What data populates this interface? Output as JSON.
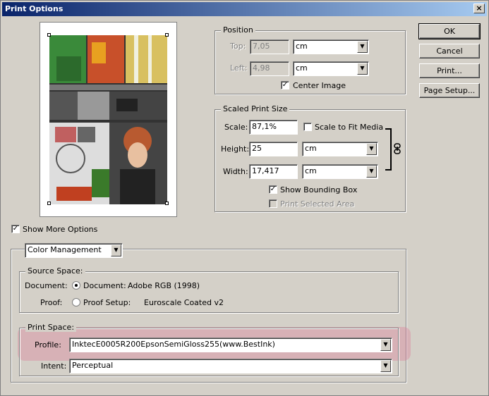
{
  "window": {
    "title": "Print Options",
    "close_glyph": "×"
  },
  "buttons": {
    "ok": "OK",
    "cancel": "Cancel",
    "print": "Print...",
    "page_setup": "Page Setup..."
  },
  "position": {
    "legend": "Position",
    "top_label": "Top:",
    "top_value": "7,05",
    "top_unit": "cm",
    "left_label": "Left:",
    "left_value": "4,98",
    "left_unit": "cm",
    "center_image": "Center Image"
  },
  "scaled": {
    "legend": "Scaled Print Size",
    "scale_label": "Scale:",
    "scale_value": "87,1%",
    "scale_to_fit": "Scale to Fit Media",
    "height_label": "Height:",
    "height_value": "25",
    "height_unit": "cm",
    "width_label": "Width:",
    "width_value": "17,417",
    "width_unit": "cm",
    "show_bounding_box": "Show Bounding Box",
    "print_selected_area": "Print Selected Area"
  },
  "show_more_options": "Show More Options",
  "more": {
    "mode_select": "Color Management",
    "source_legend": "Source Space:",
    "document_label": "Document:",
    "document_option": "Document:",
    "document_value": "Adobe RGB (1998)",
    "proof_label": "Proof:",
    "proof_option": "Proof Setup:",
    "proof_value": "Euroscale Coated v2",
    "print_legend": "Print Space:",
    "profile_label": "Profile:",
    "profile_value": "InktecE0005R200EpsonSemiGloss255(www.BestInk)",
    "intent_label": "Intent:",
    "intent_value": "Perceptual"
  },
  "icons": {
    "dropdown": "▼",
    "check": "✓",
    "link": "chain-link-icon"
  }
}
